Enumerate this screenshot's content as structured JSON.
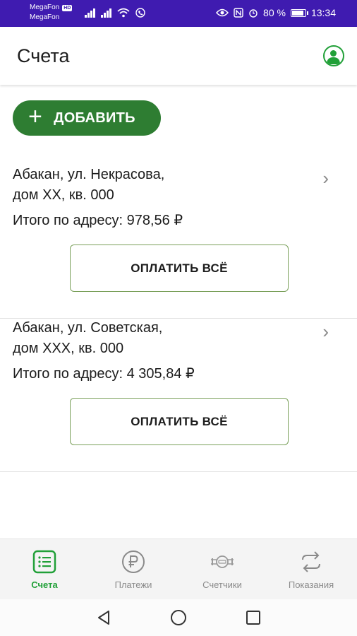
{
  "status_bar": {
    "carrier1": "MegaFon",
    "carrier1_badge": "HD",
    "carrier2": "MegaFon",
    "battery": "80 %",
    "time": "13:34"
  },
  "header": {
    "title": "Счета",
    "profile_icon": "profile-icon"
  },
  "add_button": {
    "icon": "+",
    "label": "ДОБАВИТЬ"
  },
  "accounts": [
    {
      "address_line1": "Абакан, ул. Некрасова,",
      "address_line2": "дом XX, кв. 000",
      "total": "Итого по адресу: 978,56 ₽",
      "pay_label": "ОПЛАТИТЬ ВСЁ"
    },
    {
      "address_line1": "Абакан, ул. Советская,",
      "address_line2": "дом XXX, кв. 000",
      "total": "Итого по адресу: 4 305,84 ₽",
      "pay_label": "ОПЛАТИТЬ ВСЁ"
    }
  ],
  "bottom_nav": [
    {
      "label": "Счета",
      "icon": "bills-list-icon",
      "active": true
    },
    {
      "label": "Платежи",
      "icon": "ruble-icon",
      "active": false
    },
    {
      "label": "Счетчики",
      "icon": "meter-icon",
      "active": false
    },
    {
      "label": "Показания",
      "icon": "sync-arrows-icon",
      "active": false
    }
  ],
  "colors": {
    "status_bar": "#3f1bb0",
    "accent_green": "#21a038",
    "add_button_bg": "#2e7d32",
    "pay_border": "#7aa05a"
  }
}
